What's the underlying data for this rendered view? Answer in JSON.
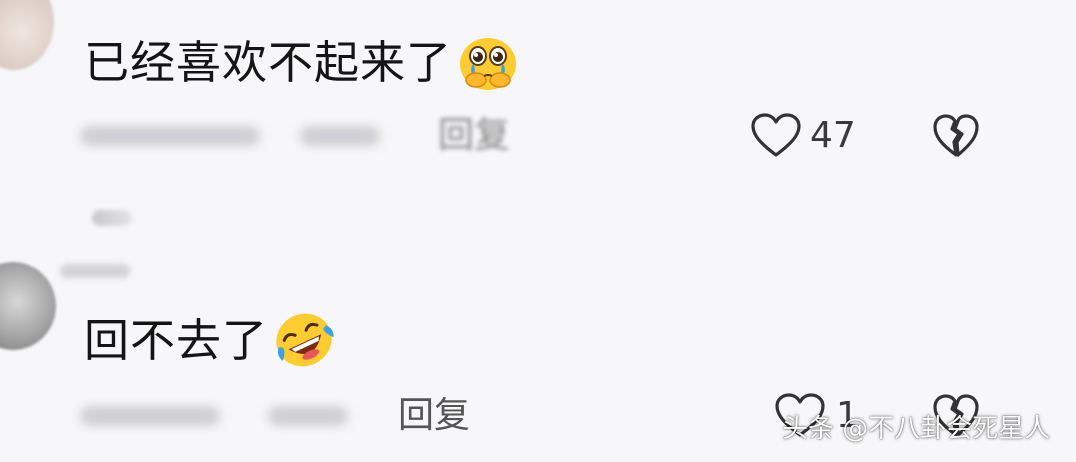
{
  "comments": [
    {
      "text": "已经喜欢不起来了",
      "emoji": "pleading-face-emoji",
      "reply_label": "回复",
      "like_count": "47"
    },
    {
      "text": "回不去了",
      "emoji": "rolling-on-floor-laughing-emoji",
      "reply_label": "回复",
      "like_count": "1"
    }
  ],
  "icons": {
    "like": "heart-outline-icon",
    "dislike": "broken-heart-outline-icon"
  },
  "watermark": {
    "text": "头条 @不八卦会死星人"
  },
  "colors": {
    "background": "#f7f7f9",
    "text": "#151515",
    "secondary_text": "#555555",
    "emoji_yellow": "#ffcc33",
    "tear_blue": "#3aa0e8"
  }
}
